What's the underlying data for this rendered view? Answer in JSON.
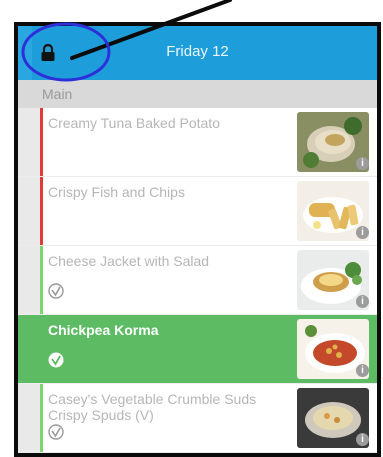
{
  "header": {
    "title": "Friday 12"
  },
  "section": {
    "title": "Main"
  },
  "items": [
    {
      "name": "Creamy Tuna Baked Potato",
      "edge_color": "#e0393a",
      "veg": false,
      "info": "i"
    },
    {
      "name": "Crispy Fish and Chips",
      "edge_color": "#e0393a",
      "veg": false,
      "info": "i"
    },
    {
      "name": "Cheese Jacket with Salad",
      "edge_color": "#7bd66f",
      "veg": true,
      "info": "i"
    },
    {
      "name": "Chickpea Korma",
      "edge_color": "#5dbb63",
      "veg": true,
      "selected": true,
      "info": "i"
    },
    {
      "name": "Casey's Vegetable Crumble Suds Crispy Spuds (V)",
      "edge_color": "#7bd66f",
      "veg": true,
      "info": "i"
    }
  ],
  "colors": {
    "header": "#1e9ddb",
    "selected": "#5dbb63",
    "annotation": "#2d2fd8"
  },
  "icons": {
    "lock": "lock-icon",
    "veg": "vegetarian-icon",
    "info": "info-icon"
  }
}
